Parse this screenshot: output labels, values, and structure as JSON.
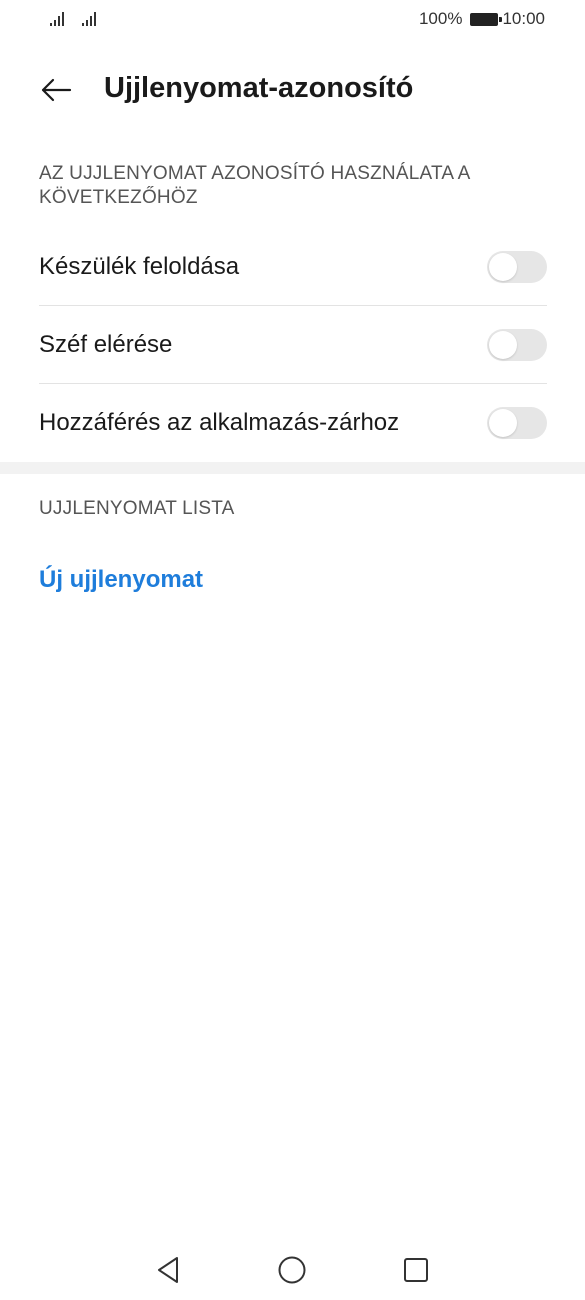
{
  "status_bar": {
    "battery_percent": "100%",
    "time": "10:00",
    "icons": [
      "signal-icon",
      "signal-icon",
      "battery-icon"
    ]
  },
  "header": {
    "title": "Ujjlenyomat-azonosító",
    "back_icon": "back-arrow-icon"
  },
  "usage_section": {
    "header": "AZ UJJLENYOMAT AZONOSÍTÓ HASZNÁLATA A KÖVETKEZŐHÖZ",
    "items": [
      {
        "label": "Készülék feloldása",
        "enabled": false
      },
      {
        "label": "Széf elérése",
        "enabled": false
      },
      {
        "label": "Hozzáférés az alkalmazás-zárhoz",
        "enabled": false
      }
    ]
  },
  "list_section": {
    "header": "UJJLENYOMAT LISTA",
    "new_fingerprint_label": "Új ujjlenyomat"
  },
  "colors": {
    "accent": "#1e7ddb",
    "toggle_off": "#e6e6e6",
    "section_header": "#555555"
  },
  "nav_bar": {
    "icons": [
      "nav-back-icon",
      "nav-home-icon",
      "nav-recents-icon"
    ]
  }
}
